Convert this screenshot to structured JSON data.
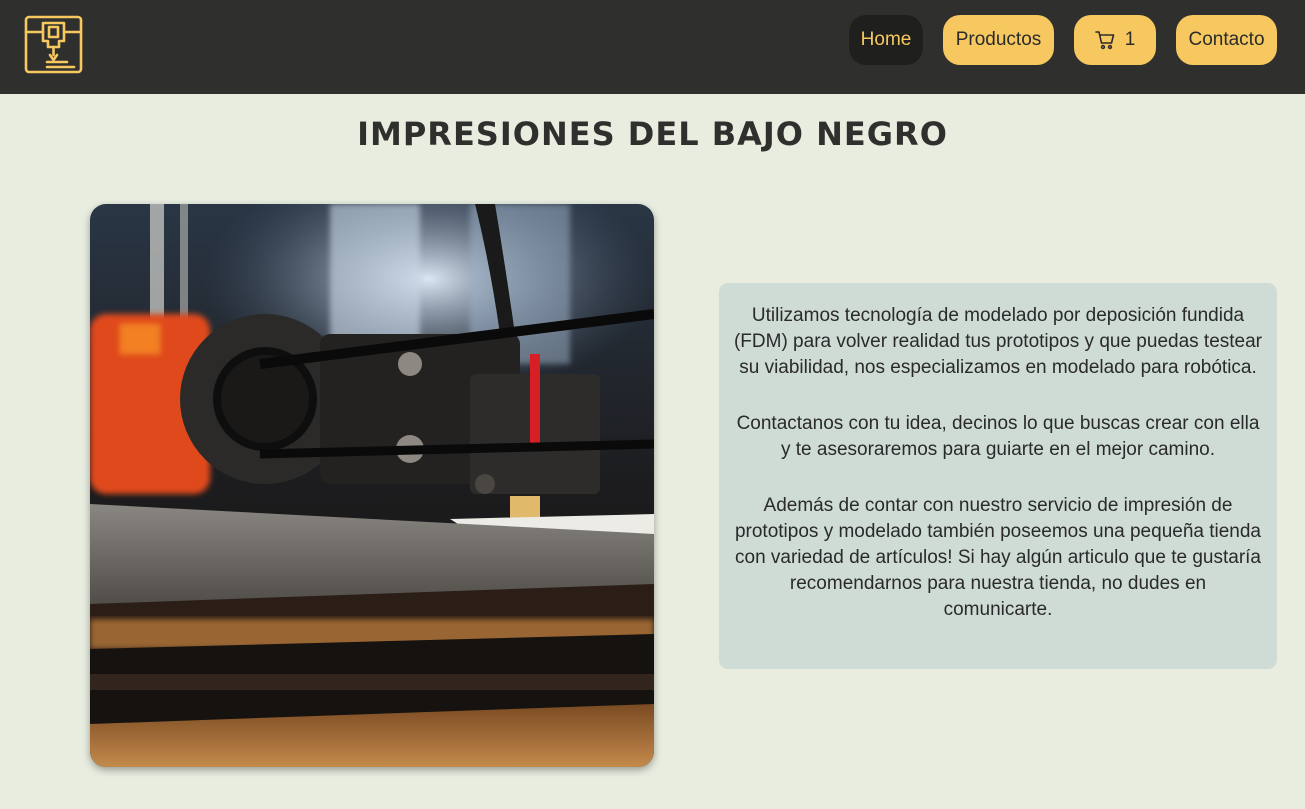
{
  "navbar": {
    "logo_icon": "3d-printer-logo-icon",
    "items": [
      {
        "label": "Home",
        "active": true
      },
      {
        "label": "Productos",
        "active": false
      },
      {
        "label": "Contacto",
        "active": false
      }
    ],
    "cart": {
      "icon": "cart-icon",
      "count": "1"
    },
    "colors": {
      "background": "#2f302d",
      "accent": "#f6c85f",
      "active_bg": "#1f1f1d"
    }
  },
  "main": {
    "title": "Impresiones del bajo negro",
    "image_description_icon": "3d-printer-photo",
    "paragraphs": [
      "Utilizamos tecnología de modelado por deposición fundida (FDM) para volver realidad tus prototipos y que puedas testear su viabilidad, nos especializamos en modelado para robótica.",
      "Contactanos con tu idea, decinos lo que buscas crear con ella y te asesoraremos para guiarte en el mejor camino.",
      "Además de contar con nuestro servicio de impresión de prototipos y modelado también poseemos una pequeña tienda con variedad de artículos! Si hay algún articulo que te gustaría recomendarnos para nuestra tienda, no dudes en comunicarte."
    ],
    "colors": {
      "page_bg": "#e8ede0",
      "info_bg": "#cfdcd5"
    }
  }
}
